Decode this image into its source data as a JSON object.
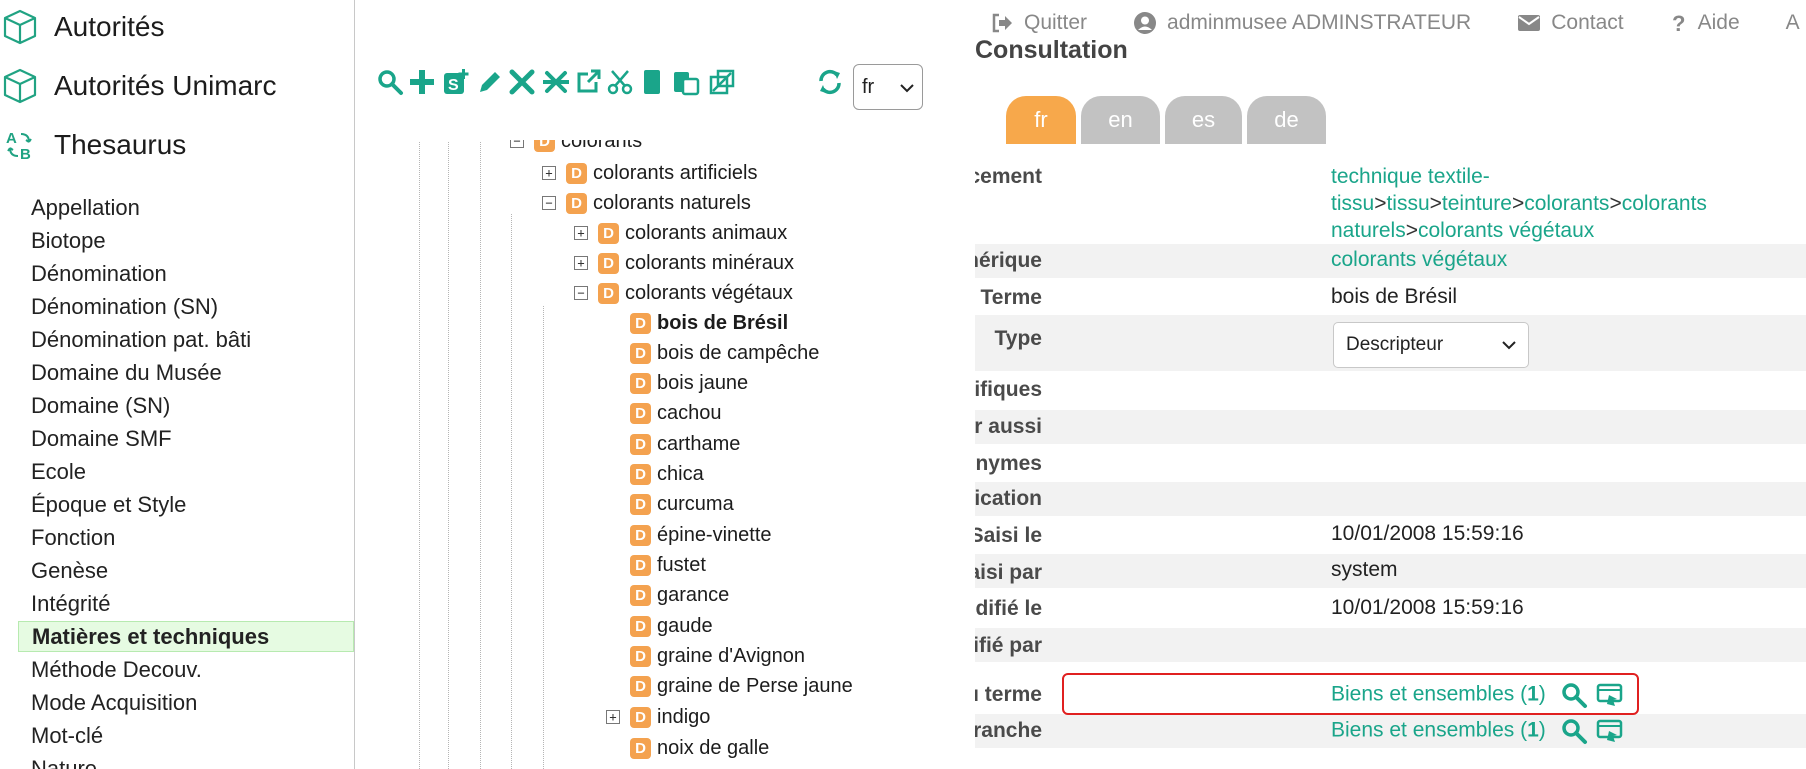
{
  "sidebar": {
    "modules": [
      {
        "label": "Autorités",
        "icon": "cube-icon"
      },
      {
        "label": "Autorités Unimarc",
        "icon": "cube-icon"
      },
      {
        "label": "Thesaurus",
        "icon": "thesaurus-icon"
      }
    ],
    "categories": [
      "Appellation",
      "Biotope",
      "Dénomination",
      "Dénomination (SN)",
      "Dénomination pat. bâti",
      "Domaine du Musée",
      "Domaine (SN)",
      "Domaine SMF",
      "Ecole",
      "Époque et Style",
      "Fonction",
      "Genèse",
      "Intégrité",
      "Matières et techniques",
      "Méthode Decouv.",
      "Mode Acquisition",
      "Mot-clé",
      "Nature"
    ],
    "active_category": "Matières et techniques"
  },
  "toolbar": {
    "buttons": [
      "search-icon",
      "add-icon",
      "add-specific-icon",
      "edit-icon",
      "delete-icon",
      "merge-icon",
      "open-external-icon",
      "cut-icon",
      "copy-icon",
      "paste-icon",
      "relink-icon"
    ],
    "refresh_icon": "refresh-icon",
    "language_select": "fr"
  },
  "tree": {
    "nodes": [
      {
        "label": "colorants",
        "toggle": "−"
      },
      {
        "label": "colorants artificiels",
        "toggle": "+"
      },
      {
        "label": "colorants naturels",
        "toggle": "−"
      },
      {
        "label": "colorants animaux",
        "toggle": "+"
      },
      {
        "label": "colorants minéraux",
        "toggle": "+"
      },
      {
        "label": "colorants végétaux",
        "toggle": "−"
      },
      {
        "label": "bois de Brésil",
        "toggle": ""
      },
      {
        "label": "bois de campêche",
        "toggle": ""
      },
      {
        "label": "bois jaune",
        "toggle": ""
      },
      {
        "label": "cachou",
        "toggle": ""
      },
      {
        "label": "carthame",
        "toggle": ""
      },
      {
        "label": "chica",
        "toggle": ""
      },
      {
        "label": "curcuma",
        "toggle": ""
      },
      {
        "label": "épine-vinette",
        "toggle": ""
      },
      {
        "label": "fustet",
        "toggle": ""
      },
      {
        "label": "garance",
        "toggle": ""
      },
      {
        "label": "gaude",
        "toggle": ""
      },
      {
        "label": "graine d'Avignon",
        "toggle": ""
      },
      {
        "label": "graine de Perse jaune",
        "toggle": ""
      },
      {
        "label": "indigo",
        "toggle": "+"
      },
      {
        "label": "noix de galle",
        "toggle": ""
      }
    ],
    "badge": "D",
    "selected": "bois de Brésil"
  },
  "topnav": {
    "items": [
      {
        "label": "Quitter",
        "icon": "logout-icon"
      },
      {
        "label": "adminmusee ADMINSTRATEUR",
        "icon": "user-icon"
      },
      {
        "label": "Contact",
        "icon": "mail-icon"
      },
      {
        "label": "Aide",
        "icon": "help-icon"
      },
      {
        "label": "A",
        "icon": ""
      }
    ]
  },
  "detail": {
    "title": "Consultation",
    "lang_tabs": [
      "fr",
      "en",
      "es",
      "de"
    ],
    "active_tab": "fr",
    "labels": {
      "premier_emplacement": "Premier emplacement",
      "generique": "Générique",
      "terme": "Terme",
      "type": "Type",
      "specifiques": "Spécifiques",
      "voir_aussi": "Voir aussi",
      "synonymes": "Synonymes",
      "note_application": "Note d'application",
      "saisi_le": "Saisi le",
      "saisi_par": "Saisi par",
      "modifie_le": "Modifié le",
      "modifie_par": "Modifié par",
      "notices_terme": "Notices liées au terme",
      "notices_branche": "Notices liées à la branche"
    },
    "path": {
      "line1": "technique textile-",
      "seg_tissu_a": "tissu",
      "seg_tissu_b": "tissu",
      "seg_teinture": "teinture",
      "seg_colorants": "colorants",
      "seg_colorants_naturels_1": "colorants",
      "seg_colorants_naturels_2": "naturels",
      "seg_colorants_vegetaux": "colorants végétaux",
      "separator": ">"
    },
    "generique": "colorants végétaux",
    "terme": "bois de Brésil",
    "type_value": "Descripteur",
    "saisi_le": "10/01/2008 15:59:16",
    "saisi_par": "system",
    "modifie_le": "10/01/2008 15:59:16",
    "notices_terme": {
      "text": "Biens et ensembles (",
      "count": "1",
      "close": ")"
    },
    "notices_branche": {
      "text": "Biens et ensembles (",
      "count": "1",
      "close": ")"
    }
  },
  "colors": {
    "accent": "#1aa58a",
    "tab_active": "#f7a84b",
    "tab_inactive": "#c2c2c2",
    "badge": "#f4a24f",
    "highlight": "#e02020"
  }
}
